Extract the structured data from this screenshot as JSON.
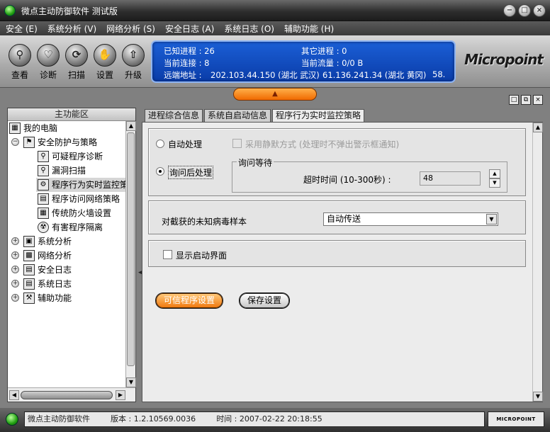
{
  "window": {
    "title": "微点主动防御软件   测试版",
    "buttons": {
      "minimize": "−",
      "maximize": "□",
      "close": "×"
    }
  },
  "menu": [
    "安全 (E)",
    "系统分析 (V)",
    "网络分析 (S)",
    "安全日志 (A)",
    "系统日志 (O)",
    "辅助功能 (H)"
  ],
  "toolbar": {
    "items": [
      {
        "label": "查看",
        "icon": "magnifier-icon"
      },
      {
        "label": "诊断",
        "icon": "heart-icon"
      },
      {
        "label": "扫描",
        "icon": "scan-icon"
      },
      {
        "label": "设置",
        "icon": "hand-icon"
      },
      {
        "label": "升级",
        "icon": "up-arrow-icon"
      }
    ]
  },
  "status_panel": {
    "known_processes": "已知进程 : 26",
    "other_processes": "其它进程 : 0",
    "current_connections": "当前连接 : 8",
    "current_traffic": "当前流量 : 0/0 B",
    "remote_label": "远端地址 :",
    "remote_addr_1": "202.103.44.150 (湖北 武汉)",
    "remote_addr_2": "61.136.241.34 (湖北 黄冈)",
    "remote_addr_3": "58."
  },
  "logo": "Micropoint",
  "left_panel": {
    "header": "主功能区",
    "tree": [
      {
        "label": "我的电脑",
        "level": 0,
        "expander": "",
        "icon": "computer-icon"
      },
      {
        "label": "安全防护与策略",
        "level": 1,
        "expander": "−",
        "icon": "flag-icon"
      },
      {
        "label": "可疑程序诊断",
        "level": 2,
        "expander": "",
        "icon": "diagnose-icon"
      },
      {
        "label": "漏洞扫描",
        "level": 2,
        "expander": "",
        "icon": "magnifier-icon"
      },
      {
        "label": "程序行为实时监控策",
        "level": 2,
        "expander": "",
        "icon": "monitor-policy-icon",
        "selected": true
      },
      {
        "label": "程序访问网络策略",
        "level": 2,
        "expander": "",
        "icon": "network-policy-icon"
      },
      {
        "label": "传统防火墙设置",
        "level": 2,
        "expander": "",
        "icon": "firewall-icon"
      },
      {
        "label": "有害程序隔离",
        "level": 2,
        "expander": "",
        "icon": "quarantine-icon"
      },
      {
        "label": "系统分析",
        "level": 1,
        "expander": "+",
        "icon": "system-analysis-icon"
      },
      {
        "label": "网络分析",
        "level": 1,
        "expander": "+",
        "icon": "network-analysis-icon"
      },
      {
        "label": "安全日志",
        "level": 1,
        "expander": "+",
        "icon": "security-log-icon"
      },
      {
        "label": "系统日志",
        "level": 1,
        "expander": "+",
        "icon": "system-log-icon"
      },
      {
        "label": "辅助功能",
        "level": 1,
        "expander": "+",
        "icon": "tools-icon"
      }
    ]
  },
  "tabs": [
    {
      "label": "进程综合信息",
      "active": false
    },
    {
      "label": "系统自启动信息",
      "active": false
    },
    {
      "label": "程序行为实时监控策略",
      "active": true
    }
  ],
  "policy": {
    "auto_handle_label": "自动处理",
    "silent_mode_label": "采用静默方式 (处理时不弹出警示框通知)",
    "ask_handle_label": "询问后处理",
    "ask_wait_title": "询问等待",
    "timeout_label": "超时时间 (10-300秒) :",
    "timeout_value": "48",
    "unknown_sample_label": "对截获的未知病毒样本",
    "unknown_sample_value": "自动传送",
    "show_startup_label": "显示启动界面",
    "trusted_button": "可信程序设置",
    "save_button": "保存设置"
  },
  "statusbar": {
    "app_name": "微点主动防御软件",
    "version": "版本 : 1.2.10569.0036",
    "time": "时间 : 2007-02-22  20:18:55",
    "logo": "MICROPOINT"
  },
  "colors": {
    "accent_blue": "#0a3ca8",
    "accent_orange": "#f06a00",
    "status_green": "#22a011"
  }
}
